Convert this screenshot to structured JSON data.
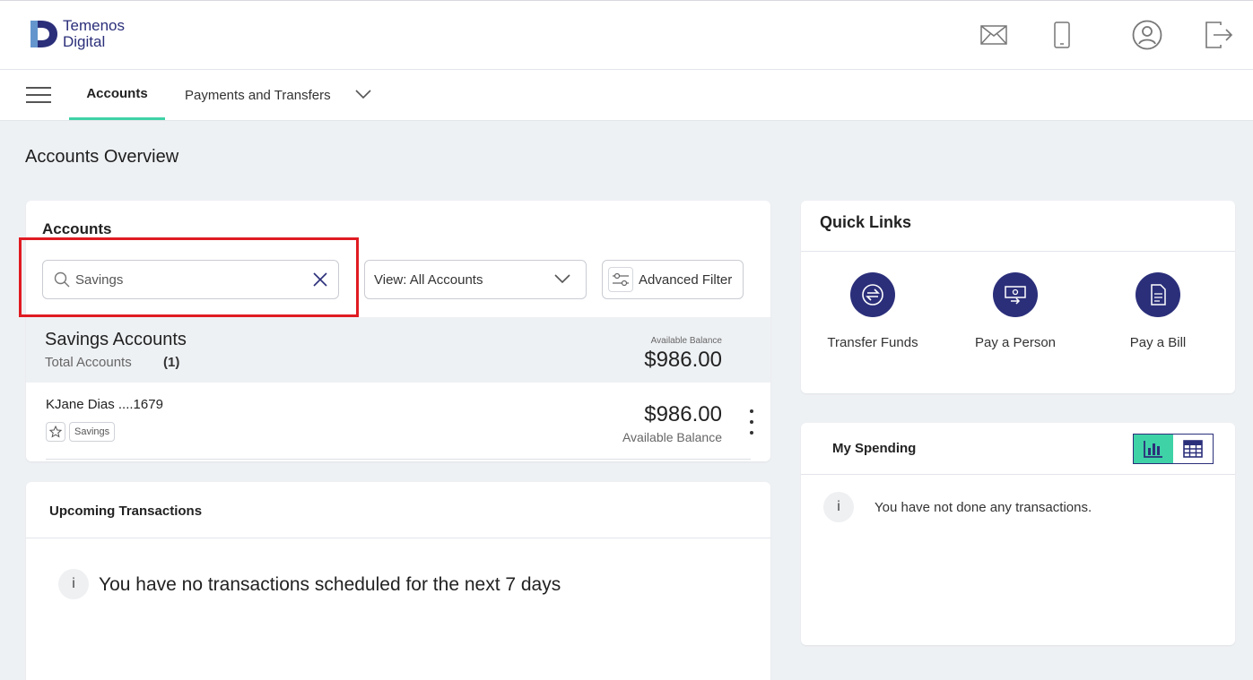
{
  "brand": {
    "line1": "Temenos",
    "line2": "Digital"
  },
  "nav": {
    "tab_accounts": "Accounts",
    "tab_payments": "Payments and Transfers"
  },
  "page": {
    "title": "Accounts Overview"
  },
  "accounts": {
    "title": "Accounts",
    "search": {
      "value": "Savings",
      "placeholder": "Search"
    },
    "view_label": "View:  All Accounts",
    "advanced_filter": "Advanced Filter",
    "group": {
      "name": "Savings Accounts",
      "total_label": "Total Accounts",
      "count": "(1)",
      "balance_label": "Available Balance",
      "balance": "$986.00"
    },
    "rows": [
      {
        "name": "KJane Dias ....1679",
        "tag": "Savings",
        "balance": "$986.00",
        "balance_label": "Available Balance"
      }
    ]
  },
  "upcoming": {
    "title": "Upcoming Transactions",
    "message": "You have no transactions scheduled for the next 7 days"
  },
  "quick_links": {
    "title": "Quick Links",
    "items": [
      {
        "label": "Transfer Funds",
        "icon": "transfer-icon"
      },
      {
        "label": "Pay a Person",
        "icon": "pay-person-icon"
      },
      {
        "label": "Pay a Bill",
        "icon": "bill-icon"
      }
    ]
  },
  "spending": {
    "title": "My Spending",
    "message": "You have not done any transactions."
  },
  "info_glyph": "i",
  "colors": {
    "brand": "#2b2f7a",
    "accent": "#3fd2a7",
    "highlight": "#e01b22"
  }
}
